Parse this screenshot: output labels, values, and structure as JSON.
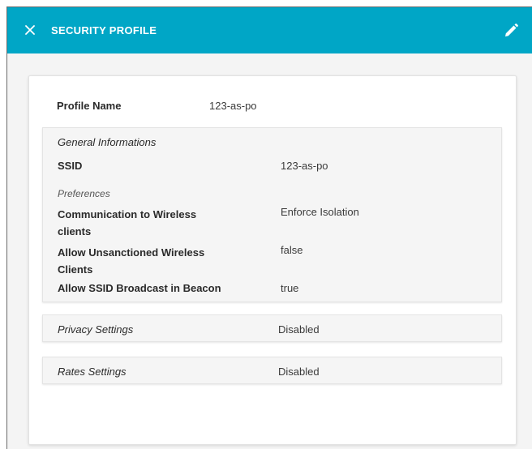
{
  "header": {
    "title": "SECURITY PROFILE",
    "close_icon": "close-icon",
    "edit_icon": "pencil-icon",
    "background": "#00a6c6"
  },
  "profile": {
    "name_label": "Profile Name",
    "name_value": "123-as-po"
  },
  "general": {
    "heading": "General Informations",
    "ssid_label": "SSID",
    "ssid_value": "123-as-po",
    "preferences_heading": "Preferences",
    "rows": [
      {
        "label_line1": "Communication to Wireless",
        "label_line2": "clients",
        "value": "Enforce Isolation"
      },
      {
        "label_line1": "Allow Unsanctioned Wireless",
        "label_line2": "Clients",
        "value": "false"
      },
      {
        "label_line1": "Allow SSID Broadcast in Beacon",
        "label_line2": "",
        "value": "true"
      }
    ]
  },
  "privacy": {
    "label": "Privacy Settings",
    "value": "Disabled"
  },
  "rates": {
    "label": "Rates Settings",
    "value": "Disabled"
  }
}
